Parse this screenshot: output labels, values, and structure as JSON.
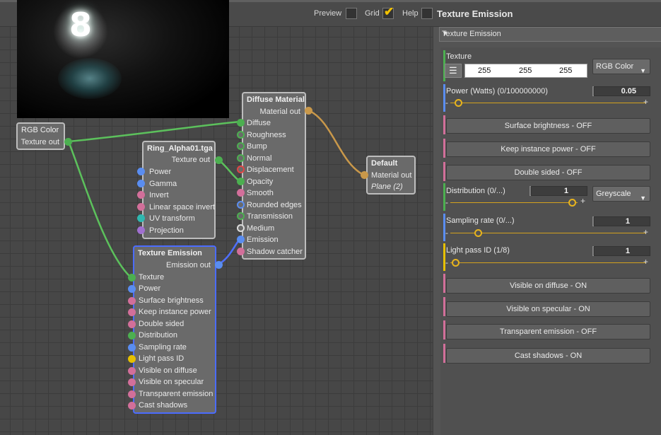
{
  "topbar": {
    "preview_label": "Preview",
    "grid_label": "Grid",
    "help_label": "Help",
    "title": "Texture Emission"
  },
  "preview": {
    "digit": "8"
  },
  "nodes": {
    "rgb": {
      "title": "RGB Color",
      "output": "Texture out"
    },
    "ring": {
      "title": "Ring_Alpha01.tga",
      "output": "Texture out",
      "inputs": [
        "Power",
        "Gamma",
        "Invert",
        "Linear space invert",
        "UV transform",
        "Projection"
      ]
    },
    "diffuse": {
      "title": "Diffuse Material",
      "output": "Material out",
      "inputs": [
        "Diffuse",
        "Roughness",
        "Bump",
        "Normal",
        "Displacement",
        "Opacity",
        "Smooth",
        "Rounded edges",
        "Transmission",
        "Medium",
        "Emission",
        "Shadow catcher"
      ]
    },
    "default": {
      "title": "Default",
      "output": "Material out",
      "subtitle": "Plane (2)"
    },
    "emission": {
      "title": "Texture Emission",
      "output": "Emission out",
      "inputs": [
        "Texture",
        "Power",
        "Surface brightness",
        "Keep instance power",
        "Double sided",
        "Distribution",
        "Sampling rate",
        "Light pass ID",
        "Visible on diffuse",
        "Visible on specular",
        "Transparent emission",
        "Cast shadows"
      ]
    }
  },
  "side": {
    "header": "Texture Emission",
    "texture": {
      "label": "Texture",
      "r": "255",
      "g": "255",
      "b": "255",
      "mode": "RGB Color"
    },
    "power": {
      "label": "Power (Watts) (0/100000000)",
      "value": "0.05",
      "slider_fraction": 0.06
    },
    "surface_brightness": "Surface brightness - OFF",
    "keep_instance_power": "Keep instance power - OFF",
    "double_sided": "Double sided - OFF",
    "distribution": {
      "label": "Distribution (0/...)",
      "value": "1",
      "mode": "Greyscale",
      "slider_fraction": 1.0
    },
    "sampling_rate": {
      "label": "Sampling rate (0/...)",
      "value": "1",
      "slider_fraction": 0.18
    },
    "light_pass": {
      "label": "Light pass ID (1/8)",
      "value": "1",
      "slider_fraction": 0.0
    },
    "visible_on_diffuse": "Visible on diffuse - ON",
    "visible_on_specular": "Visible on specular - ON",
    "transparent_emission": "Transparent emission - OFF",
    "cast_shadows": "Cast shadows - ON"
  },
  "colors": {
    "pin_green": "#4caf50",
    "pin_blue": "#5a8df0",
    "pin_pink": "#d26f9a",
    "pin_red": "#e04545",
    "pin_teal": "#2fb8b0",
    "pin_purple": "#a070d0",
    "pin_yellow": "#e6c000",
    "pin_orange": "#c9984a",
    "selected_border": "#4b6cff",
    "slider": "#d4a21e"
  }
}
